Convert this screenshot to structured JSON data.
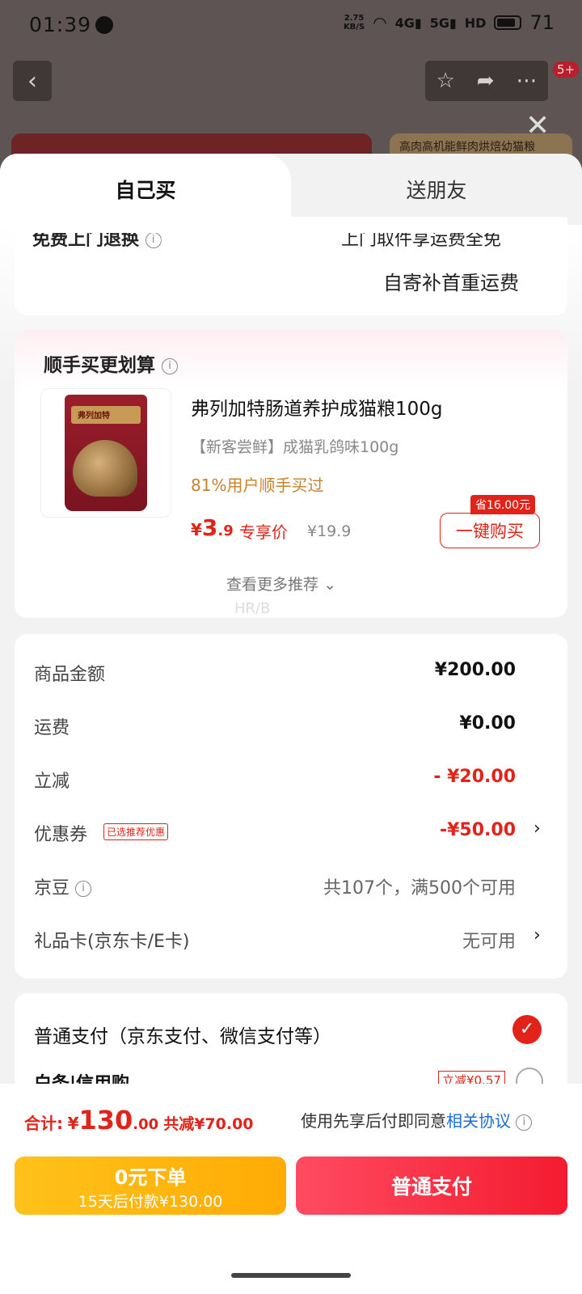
{
  "status": {
    "time": "01:39",
    "speed_top": "2.75",
    "speed_bottom": "KB/S",
    "net1": "4G",
    "net2": "5G",
    "hd": "HD",
    "battery": "71"
  },
  "nav": {
    "badge": "5+",
    "banner_text": "高肉高机能鲜肉烘焙幼猫粮"
  },
  "tabs": {
    "self": "自己买",
    "gift": "送朋友"
  },
  "return": {
    "label": "免费上门退换",
    "right1": "上门取件享运费全免",
    "right2": "自寄补首重运费"
  },
  "rec": {
    "title": "顺手买更划算",
    "bag_brand": "弗列加特",
    "name": "弗列加特肠道养护成猫粮100g",
    "spec": "【新客尝鲜】成猫乳鸽味100g",
    "ratio": "81%用户顺手买过",
    "price_sym": "¥",
    "price_int": "3",
    "price_dec": ".9",
    "price_tag": "专享价",
    "orig": "¥19.9",
    "save": "省16.00元",
    "buy": "一键购买",
    "more": "查看更多推荐",
    "faint": "HR/B"
  },
  "amounts": {
    "goods_label": "商品金额",
    "goods_val": "¥200.00",
    "ship_label": "运费",
    "ship_val": "¥0.00",
    "cut_label": "立减",
    "cut_val": "- ¥20.00",
    "coupon_label": "优惠券",
    "coupon_tag": "已选推荐优惠",
    "coupon_val": "-¥50.00",
    "bean_label": "京豆",
    "bean_val": "共107个，满500个可用",
    "card_label": "礼品卡(京东卡/E卡)",
    "card_val": "无可用"
  },
  "payment": {
    "normal": "普通支付（京东支付、微信支付等）",
    "baitiao": "白条|信用购",
    "baitiao_tag": "立减¥0.57"
  },
  "bottom": {
    "total_label": "合计:",
    "total_sym": "¥",
    "total_int": "130",
    "total_dec": ".00",
    "total_cut": "共减¥70.00",
    "agree": "使用先享后付即同意",
    "agree_link": "相关协议",
    "zero_title": "0元下单",
    "zero_sub": "15天后付款¥130.00",
    "pay": "普通支付"
  }
}
